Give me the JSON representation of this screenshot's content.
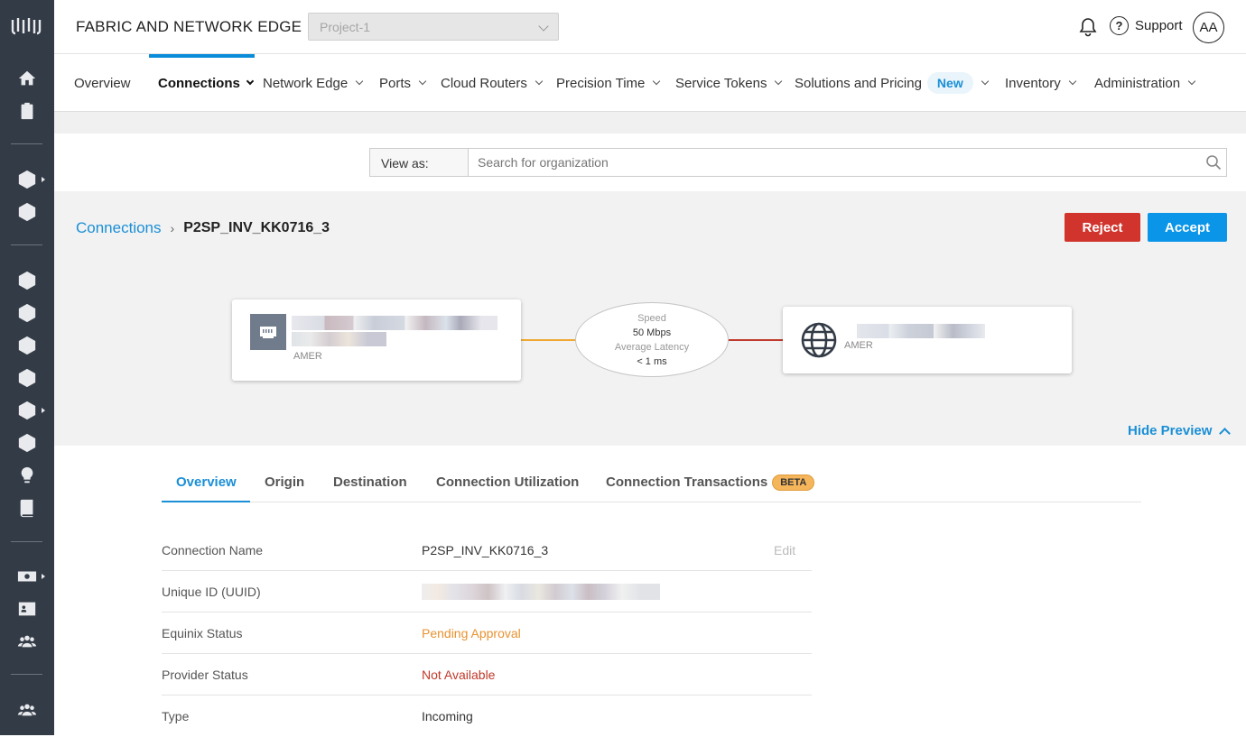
{
  "app": {
    "title": "FABRIC AND NETWORK EDGE",
    "project": "Project-1"
  },
  "header": {
    "support_label": "Support",
    "avatar_initials": "AA"
  },
  "nav": {
    "items": [
      "Overview",
      "Connections",
      "Network Edge",
      "Ports",
      "Cloud Routers",
      "Precision Time",
      "Service Tokens",
      "Solutions and Pricing",
      "Inventory",
      "Administration"
    ],
    "new_badge": "New",
    "active": "Connections"
  },
  "viewas": {
    "label": "View as:",
    "placeholder": "Search for organization"
  },
  "breadcrumb": {
    "parent": "Connections",
    "current": "P2SP_INV_KK0716_3"
  },
  "actions": {
    "reject": "Reject",
    "accept": "Accept"
  },
  "diagram": {
    "a_side_region": "AMER",
    "z_side_region": "AMER",
    "speed_label": "Speed",
    "speed_value": "50 Mbps",
    "latency_label": "Average Latency",
    "latency_value": "< 1 ms"
  },
  "hide_preview": "Hide Preview",
  "tabs": [
    "Overview",
    "Origin",
    "Destination",
    "Connection Utilization",
    "Connection Transactions"
  ],
  "beta_badge": "BETA",
  "details": {
    "edit_label": "Edit",
    "rows": [
      {
        "key": "Connection Name",
        "value": "P2SP_INV_KK0716_3"
      },
      {
        "key": "Unique ID (UUID)",
        "value": ""
      },
      {
        "key": "Equinix Status",
        "value": "Pending Approval"
      },
      {
        "key": "Provider Status",
        "value": "Not Available"
      },
      {
        "key": "Type",
        "value": "Incoming"
      }
    ]
  },
  "colors": {
    "accent": "#1a8fd6",
    "reject": "#d0342c",
    "accept": "#0a95e8",
    "pending": "#e8922f",
    "not_available": "#c0392b",
    "sidebar": "#333b46"
  }
}
